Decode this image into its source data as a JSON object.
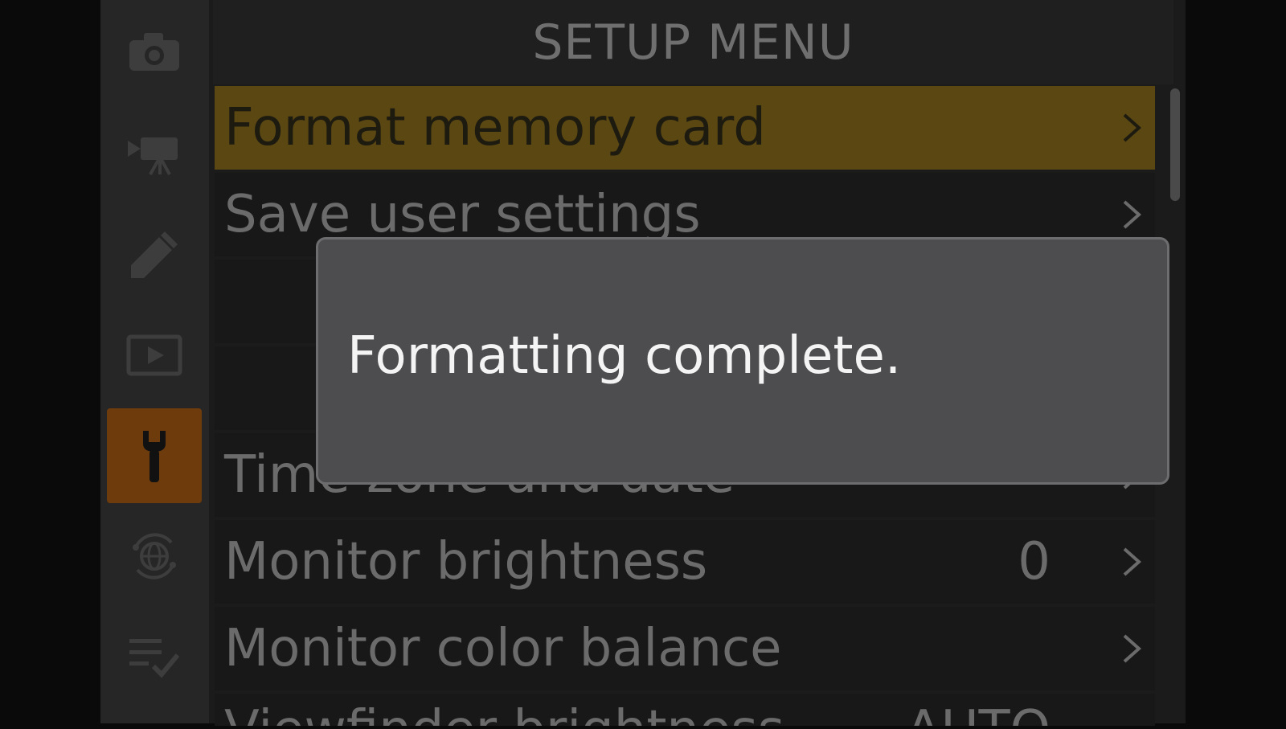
{
  "screen": {
    "title": "SETUP MENU"
  },
  "rail": {
    "items": [
      {
        "icon": "camera-icon",
        "active": false
      },
      {
        "icon": "movie-camera-icon",
        "active": false
      },
      {
        "icon": "pencil-icon",
        "active": false
      },
      {
        "icon": "playback-icon",
        "active": false
      },
      {
        "icon": "wrench-icon",
        "active": true
      },
      {
        "icon": "network-globe-icon",
        "active": false
      },
      {
        "icon": "my-menu-icon",
        "active": false
      }
    ],
    "active_color": "#6e3c0c"
  },
  "menu": {
    "items": [
      {
        "label": "Format memory card",
        "value": "",
        "selected": true
      },
      {
        "label": "Save user settings",
        "value": "",
        "selected": false
      },
      {
        "label": "",
        "value": "",
        "selected": false
      },
      {
        "label": "",
        "value": "",
        "selected": false
      },
      {
        "label": "Time zone and date",
        "value": "",
        "selected": false
      },
      {
        "label": "Monitor brightness",
        "value": "0",
        "selected": false
      },
      {
        "label": "Monitor color balance",
        "value": "",
        "selected": false
      },
      {
        "label": "Viewfinder brightness",
        "value": "AUTO",
        "selected": false
      }
    ],
    "selected_color": "#5a4712"
  },
  "dialog": {
    "message": "Formatting complete."
  }
}
